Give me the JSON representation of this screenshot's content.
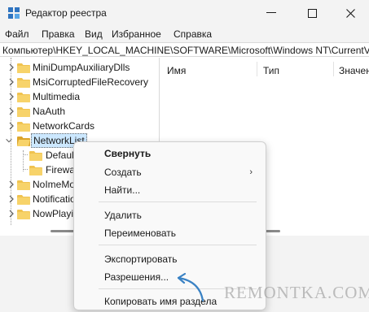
{
  "window": {
    "title": "Редактор реестра",
    "controls": {
      "minimize": "—",
      "maximize": "☐",
      "close": "✕"
    }
  },
  "menu": [
    {
      "label": "Файл"
    },
    {
      "label": "Правка"
    },
    {
      "label": "Вид"
    },
    {
      "label": "Избранное"
    },
    {
      "label": "Справка"
    }
  ],
  "address": {
    "path": "Компьютер\\HKEY_LOCAL_MACHINE\\SOFTWARE\\Microsoft\\Windows NT\\CurrentVersion\\NetworkList"
  },
  "tree": {
    "items": [
      {
        "label": "MiniDumpAuxiliaryDlls",
        "expanded": false
      },
      {
        "label": "MsiCorruptedFileRecovery",
        "expanded": false
      },
      {
        "label": "Multimedia",
        "expanded": false
      },
      {
        "label": "NaAuth",
        "expanded": false
      },
      {
        "label": "NetworkCards",
        "expanded": false
      },
      {
        "label": "NetworkList",
        "expanded": true,
        "selected": true
      },
      {
        "label": "DefaultMediaCost",
        "child": true
      },
      {
        "label": "Firewall",
        "child": true
      },
      {
        "label": "NoImeModeImes",
        "expanded": false
      },
      {
        "label": "Notifications",
        "expanded": false
      },
      {
        "label": "NowPlayingSessionManager",
        "expanded": false
      }
    ]
  },
  "values": {
    "columns": [
      {
        "label": "Имя"
      },
      {
        "label": "Тип"
      },
      {
        "label": "Значение"
      }
    ]
  },
  "context_menu": {
    "items": [
      {
        "label": "Свернуть",
        "bold": true
      },
      {
        "label": "Создать",
        "submenu": true
      },
      {
        "label": "Найти..."
      },
      {
        "label": "Удалить"
      },
      {
        "label": "Переименовать"
      },
      {
        "label": "Экспортировать"
      },
      {
        "label": "Разрешения..."
      },
      {
        "label": "Копировать имя раздела"
      }
    ],
    "submenu_arrow": "›"
  },
  "watermark": {
    "text": "REMONTKA.COM"
  },
  "colors": {
    "folder": "#f0c350",
    "folder_dark": "#dca52c",
    "selection": "#cce8ff",
    "pointer": "#3a82c4"
  }
}
